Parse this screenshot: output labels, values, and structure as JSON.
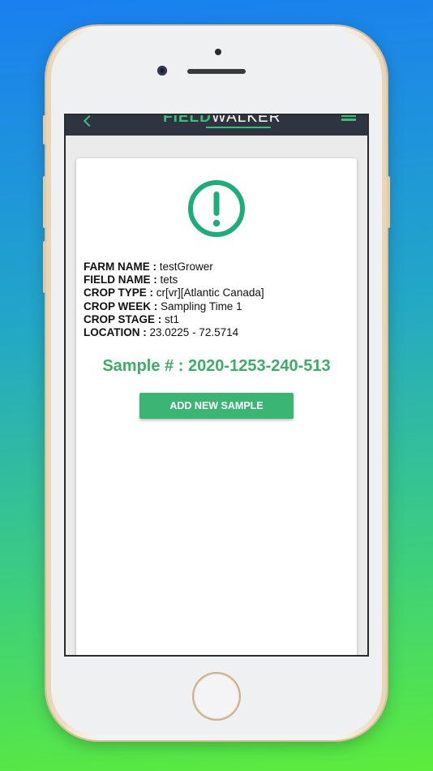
{
  "colors": {
    "accent": "#3bb574",
    "sample_text": "#3dad69",
    "header_bg": "#2f3441",
    "card_bg": "#ffffff"
  },
  "header": {
    "logo_field": "FIELD",
    "logo_walker": "WALKER",
    "back_icon": "chevron-left-icon",
    "menu_icon": "hamburger-menu-icon"
  },
  "status_icon": "alert-circle-icon",
  "details": [
    {
      "key": "FARM NAME :",
      "value": "testGrower"
    },
    {
      "key": "FIELD NAME :",
      "value": "tets"
    },
    {
      "key": "CROP TYPE :",
      "value": "cr[vr][Atlantic Canada]"
    },
    {
      "key": "CROP WEEK :",
      "value": "Sampling Time 1"
    },
    {
      "key": "CROP STAGE :",
      "value": "st1"
    },
    {
      "key": "LOCATION :",
      "value": "23.0225 - 72.5714"
    }
  ],
  "sample": {
    "label": "Sample # : 2020-1253-240-513"
  },
  "actions": {
    "add_new_sample": "ADD NEW SAMPLE"
  }
}
